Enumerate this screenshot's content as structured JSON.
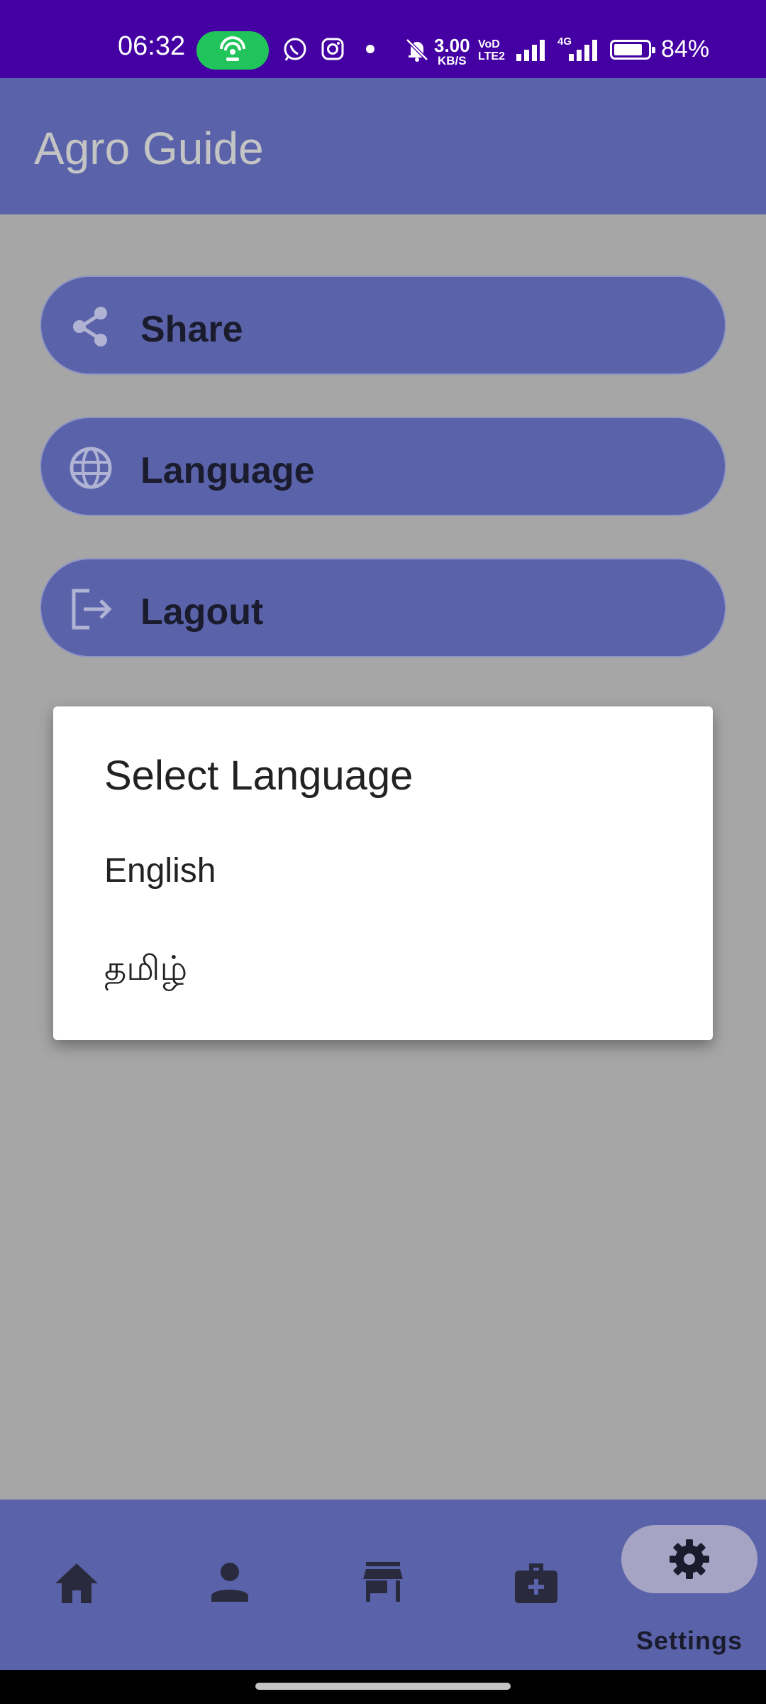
{
  "status_bar": {
    "time": "06:32",
    "speed_value": "3.00",
    "speed_unit": "KB/S",
    "volte_top": "VoD",
    "volte_bottom": "LTE2",
    "network_type": "4G",
    "battery_percent": "84%",
    "battery_level": 0.84,
    "icons": [
      "hotspot-icon",
      "whatsapp-icon",
      "instagram-icon",
      "notification-dot-icon",
      "bell-muted-icon",
      "signal-icon",
      "signal-4g-icon",
      "battery-icon"
    ]
  },
  "app_bar": {
    "title": "Agro Guide"
  },
  "settings": {
    "share_label": "Share",
    "language_label": "Language",
    "logout_label": "Lagout"
  },
  "dialog": {
    "title": "Select Language",
    "options": [
      "English",
      "தமிழ்"
    ]
  },
  "bottom_nav": {
    "items": [
      "home-icon",
      "person-icon",
      "store-icon",
      "medical-kit-icon",
      "gear-icon"
    ],
    "active_label": "Settings"
  },
  "colors": {
    "status_bar": "#4400a3",
    "primary": "#5a63a9",
    "scrim_background": "#a6a6a6",
    "active_pill": "#a6a4c5"
  }
}
